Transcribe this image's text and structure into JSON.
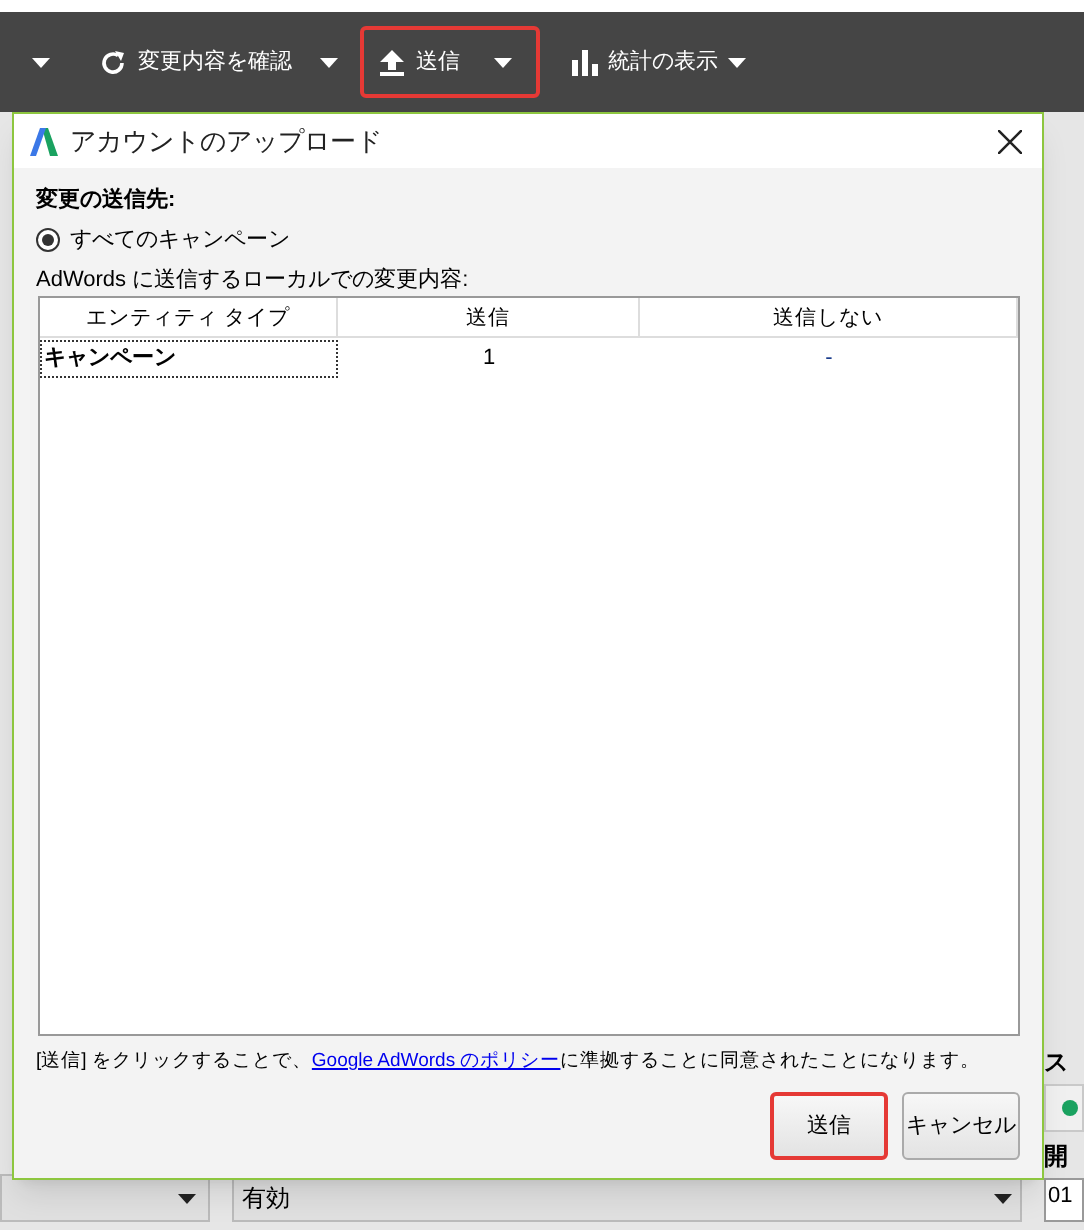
{
  "toolbar": {
    "items": [
      {
        "kind": "caret"
      },
      {
        "kind": "button",
        "label": "変更内容を確認",
        "highlighted": false
      },
      {
        "kind": "caret"
      },
      {
        "kind": "split",
        "label": "送信",
        "highlighted": true
      },
      {
        "kind": "menu",
        "label": "統計の表示",
        "highlighted": false
      }
    ]
  },
  "background": {
    "status_label": "ス",
    "start_label": "開",
    "start_value": "01",
    "dropdown_value": "有効"
  },
  "dialog": {
    "title": "アカウントのアップロード",
    "destination_label": "変更の送信先:",
    "destinations": [
      {
        "label": "すべてのキャンペーン",
        "selected": true
      }
    ],
    "changes_label": "AdWords に送信するローカルでの変更内容:",
    "table": {
      "columns": [
        "エンティティ タイプ",
        "送信",
        "送信しない"
      ],
      "rows": [
        {
          "cells": [
            "キャンペーン",
            "1",
            "-"
          ],
          "selected": true
        }
      ]
    },
    "notice_before": "[送信] をクリックすることで、",
    "notice_link": "Google AdWords のポリシー",
    "notice_after": "に準拠することに同意されたことになります。",
    "buttons": [
      {
        "label": "送信",
        "highlighted": true
      },
      {
        "label": "キャンセル",
        "highlighted": false
      }
    ]
  }
}
